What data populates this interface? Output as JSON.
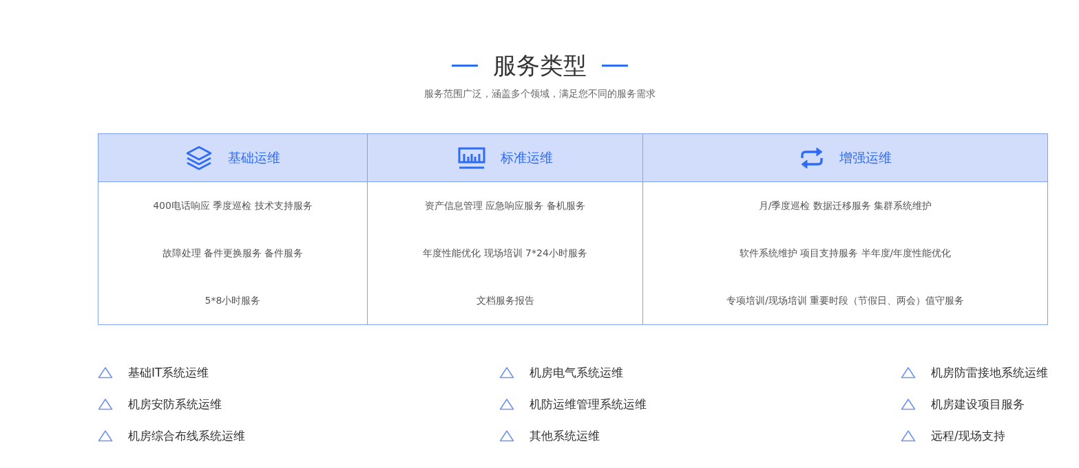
{
  "section": {
    "title": "服务类型",
    "subtitle": "服务范围广泛，涵盖多个领域，满足您不同的服务需求"
  },
  "plans": [
    {
      "name": "基础运维",
      "items": [
        "400电话响应 季度巡检 技术支持服务",
        "故障处理 备件更换服务 备件服务",
        "5*8小时服务"
      ]
    },
    {
      "name": "标准运维",
      "items": [
        "资产信息管理 应急响应服务 备机服务",
        "年度性能优化 现场培训 7*24小时服务",
        "文档服务报告"
      ]
    },
    {
      "name": "增强运维",
      "items": [
        "月/季度巡检 数据迁移服务 集群系统维护",
        "软件系统维护 项目支持服务 半年度/年度性能优化",
        "专项培训/现场培训 重要时段（节假日、两会）值守服务"
      ]
    }
  ],
  "feature_columns": [
    [
      "基础IT系统运维",
      "机房安防系统运维",
      "机房综合布线系统运维"
    ],
    [
      "机房电气系统运维",
      "机防运维管理系统运维",
      "其他系统运维"
    ],
    [
      "机房防雷接地系统运维",
      "机房建设项目服务",
      "远程/现场支持"
    ]
  ]
}
